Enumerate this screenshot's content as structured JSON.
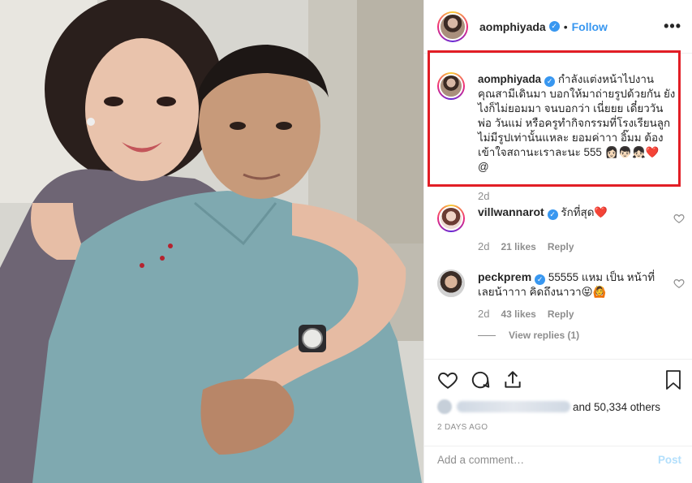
{
  "post": {
    "image_alt": "aomphiyada couple photo",
    "author": "aomphiyada",
    "follow_label": "Follow",
    "dot": "•",
    "more_label": "•••"
  },
  "caption": {
    "username": "aomphiyada",
    "lines": [
      "กำลังแต่งหน้าไปงาน",
      "คุณสามีเดินมา บอกให้มาถ่ายรูปด้วยกัน ยัง",
      "ไงก็ไม่ยอมมา จนบอกว่า เนี่ยยย เดี๋ยววัน",
      "พ่อ วันแม่ หรือครูทำกิจกรรมที่โรงเรียนลูก",
      "ไม่มีรูปเท่านั้นแหละ ยอมค่าาา อิ๊มม ต้อง",
      "เข้าใจสถานะเราละนะ 555 👩🏻👦🏻👧🏻❤️",
      "@"
    ],
    "time": "2d"
  },
  "comments": [
    {
      "username": "villwannarot",
      "text": "รักที่สุด❤️",
      "time": "2d",
      "likes": "21 likes",
      "reply": "Reply"
    },
    {
      "username": "peckprem",
      "text": "55555 แหม เป็น หน้าที่เลยน้าาาา คิดถึงนาวา😝🙆",
      "time": "2d",
      "likes": "43 likes",
      "reply": "Reply",
      "view_replies": "View replies (1)"
    }
  ],
  "likes": {
    "others": "and 50,334 others"
  },
  "posted": "2 DAYS AGO",
  "add_comment": {
    "placeholder": "Add a comment…",
    "post_label": "Post"
  },
  "colors": {
    "accent": "#3897f0",
    "highlight_box": "#e21e26",
    "heart": "#e3263b"
  },
  "icons": [
    "heart-icon",
    "comment-icon",
    "share-icon",
    "bookmark-icon",
    "verified-icon",
    "more-icon"
  ]
}
